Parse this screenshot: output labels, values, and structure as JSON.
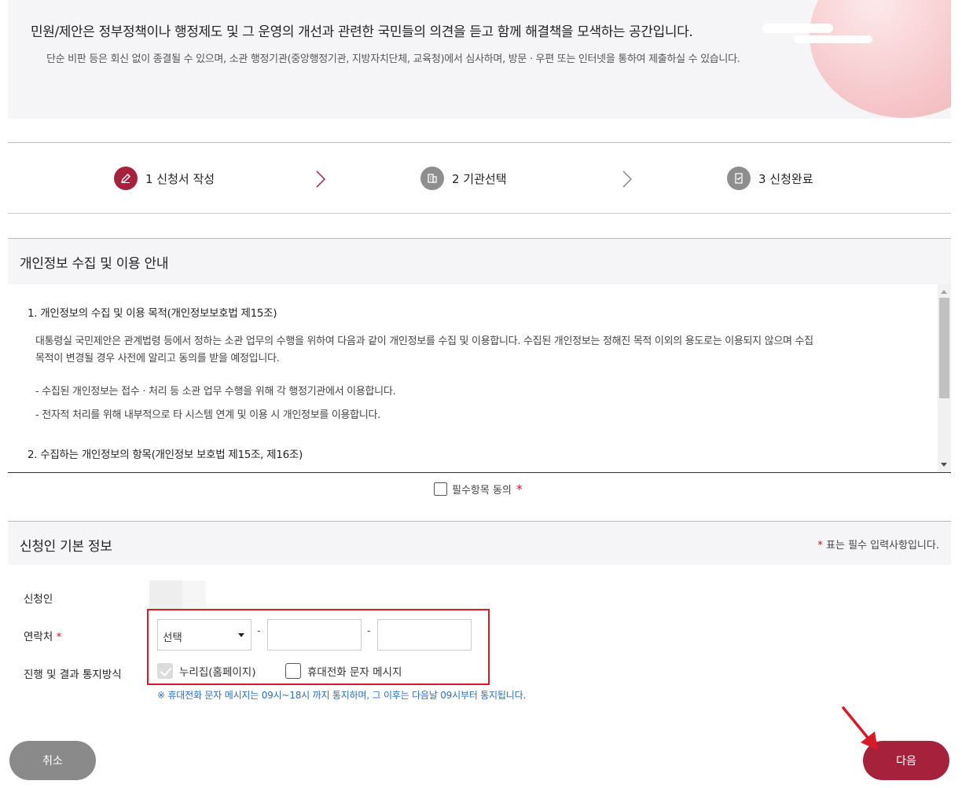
{
  "intro": {
    "title": "민원/제안은 정부정책이나 행정제도 및 그 운영의 개선과 관련한 국민들의 의견을 듣고 함께 해결책을 모색하는 공간입니다.",
    "description": "단순 비판 등은 회신 없이 종결될 수 있으며, 소관 행정기관(중앙행정기관, 지방자치단체, 교육청)에서 심사하며, 방문 · 우편 또는 인터넷을 통하여 제출하실 수 있습니다."
  },
  "steps": [
    {
      "label": "1 신청서 작성",
      "icon": "pencil-icon",
      "active": true
    },
    {
      "label": "2 기관선택",
      "icon": "building-icon",
      "active": false
    },
    {
      "label": "3 신청완료",
      "icon": "document-check-icon",
      "active": false
    }
  ],
  "privacy": {
    "title": "개인정보 수집 및 이용 안내",
    "item1_heading": "1. 개인정보의 수집 및 이용 목적(개인정보보호법 제15조)",
    "item1_line1": "대통령실 국민제안은 관계법령 등에서 정하는 소관 업무의 수행을 위하여 다음과 같이 개인정보를 수집 및 이용합니다. 수집된 개인정보는 정해진 목적 이외의 용도로는 이용되지 않으며 수집",
    "item1_line2": "목적이 변경될 경우 사전에 알리고 동의를 받을 예정입니다.",
    "bullet1": "- 수집된 개인정보는 접수 · 처리 등 소관 업무 수행을 위해 각 행정기관에서 이용합니다.",
    "bullet2": "- 전자적 처리를 위해 내부적으로 타 시스템 연계 및 이용 시 개인정보를 이용합니다.",
    "item2_heading": "2. 수집하는 개인정보의 항목(개인정보 보호법 제15조, 제16조)",
    "agree_label": "필수항목 동의",
    "required_mark": "*"
  },
  "applicant": {
    "title": "신청인 기본 정보",
    "required_note_mark": "*",
    "required_note": "표는 필수 입력사항입니다.",
    "name_label": "신청인",
    "contact_label": "연락처",
    "contact_required": "*",
    "select_value": "선택",
    "dash": "-",
    "notify_label": "진행 및 결과 통지방식",
    "notify_option1": "누리집(홈페이지)",
    "notify_option1_checked": true,
    "notify_option2": "휴대전화 문자 메시지",
    "notify_option2_checked": false,
    "sms_note": "※ 휴대전화 문자 메시지는 09시~18시 까지 통지하며, 그 이후는 다음날 09시부터 통지됩니다."
  },
  "buttons": {
    "cancel": "취소",
    "next": "다음"
  },
  "colors": {
    "accent": "#a6223c",
    "annotation": "#d71a25",
    "note_blue": "#2d6fb6"
  }
}
